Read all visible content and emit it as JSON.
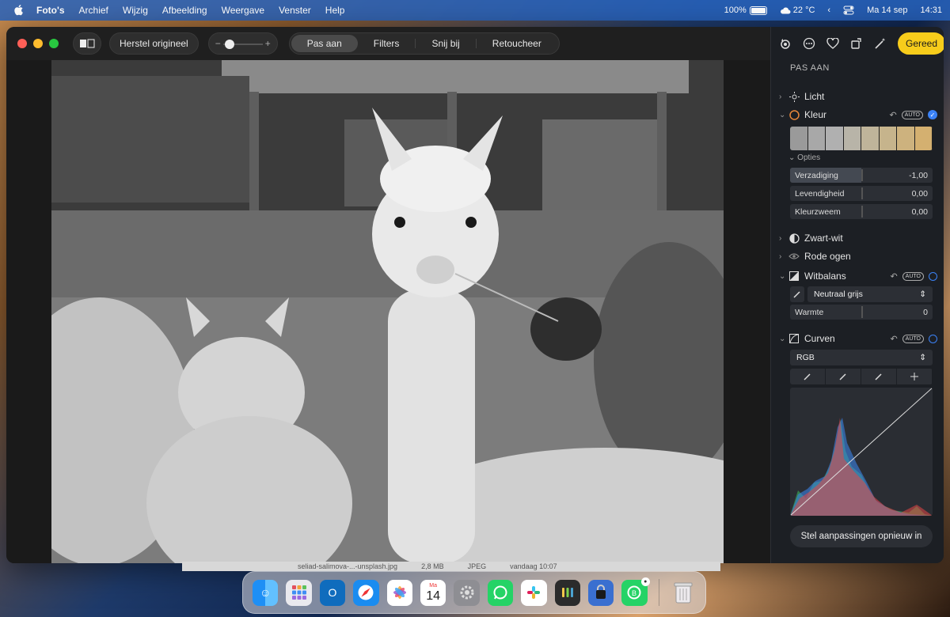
{
  "menubar": {
    "apple_icon": "apple-icon",
    "items": [
      "Foto's",
      "Archief",
      "Wijzig",
      "Afbeelding",
      "Weergave",
      "Venster",
      "Help"
    ],
    "battery_percent": "100%",
    "battery_level": 1.0,
    "temperature": "22 °C",
    "date": "Ma 14 sep",
    "time": "14:31"
  },
  "toolbar": {
    "restore_label": "Herstel origineel",
    "slider_minus": "−",
    "slider_plus": "+",
    "tabs": [
      {
        "label": "Pas aan",
        "active": true
      },
      {
        "label": "Filters",
        "active": false
      },
      {
        "label": "Snij bij",
        "active": false
      },
      {
        "label": "Retoucheer",
        "active": false
      }
    ]
  },
  "sidebar": {
    "done_label": "Gereed",
    "title": "PAS AAN",
    "auto_label": "AUTO",
    "sections": {
      "licht": "Licht",
      "kleur": "Kleur",
      "opties": "Opties",
      "zwartwit": "Zwart-wit",
      "rodeogen": "Rode ogen",
      "witbalans": "Witbalans",
      "curven": "Curven"
    },
    "kleur_sliders": [
      {
        "label": "Verzadiging",
        "value": "-1,00",
        "level": -1.0
      },
      {
        "label": "Levendigheid",
        "value": "0,00",
        "level": 0
      },
      {
        "label": "Kleurzweem",
        "value": "0,00",
        "level": 0
      }
    ],
    "witbalans_select": "Neutraal grijs",
    "warmte": {
      "label": "Warmte",
      "value": "0",
      "level": 0
    },
    "curven_channel": "RGB",
    "reset_label": "Stel aanpassingen opnieuw in"
  },
  "finder_strip": {
    "filename": "seliad-salimova-...-unsplash.jpg",
    "size": "2,8 MB",
    "type": "JPEG",
    "date": "vandaag 10:07"
  },
  "dock": {
    "calendar_month": "Ma",
    "calendar_day": "14",
    "items": [
      "finder-icon",
      "launchpad-icon",
      "outlook-icon",
      "safari-icon",
      "photos-icon",
      "calendar-icon",
      "settings-icon",
      "whatsapp-icon",
      "slack-icon",
      "keychain-icon",
      "vpn-icon",
      "whatsapp-business-icon",
      "trash-icon"
    ]
  },
  "colors": {
    "accent_yellow": "#f7cc1b",
    "accent_blue": "#3b82f6",
    "menubar_blue": "#2864be"
  }
}
